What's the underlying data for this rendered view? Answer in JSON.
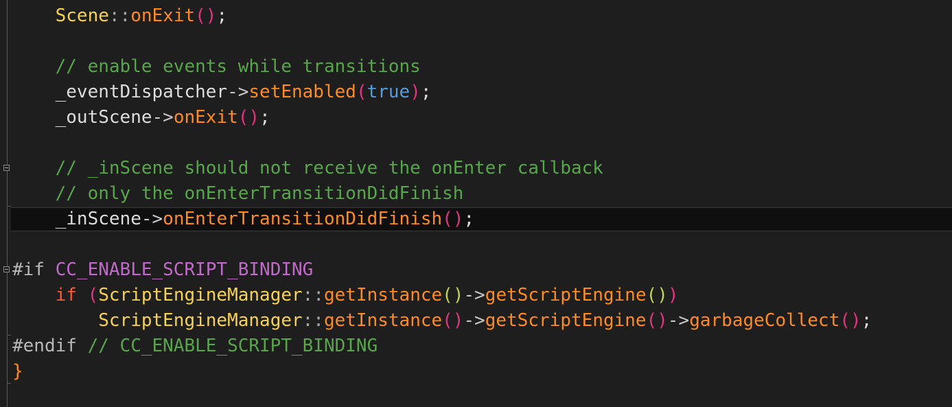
{
  "editor": {
    "lines": [
      {
        "id": 1,
        "indent": "    ",
        "tokens": [
          {
            "t": "Scene",
            "c": "tk-type"
          },
          {
            "t": "::",
            "c": "tk-ns"
          },
          {
            "t": "onExit",
            "c": "tk-func"
          },
          {
            "t": "()",
            "c": "tk-paren"
          },
          {
            "t": ";",
            "c": "tk-punct"
          }
        ]
      },
      {
        "id": 2,
        "indent": "",
        "tokens": []
      },
      {
        "id": 3,
        "indent": "    ",
        "tokens": [
          {
            "t": "// enable events while transitions",
            "c": "tk-comment"
          }
        ]
      },
      {
        "id": 4,
        "indent": "    ",
        "tokens": [
          {
            "t": "_eventDispatcher",
            "c": "tk-var"
          },
          {
            "t": "->",
            "c": "tk-op"
          },
          {
            "t": "setEnabled",
            "c": "tk-func"
          },
          {
            "t": "(",
            "c": "tk-paren"
          },
          {
            "t": "true",
            "c": "tk-kw-blue"
          },
          {
            "t": ")",
            "c": "tk-paren"
          },
          {
            "t": ";",
            "c": "tk-punct"
          }
        ]
      },
      {
        "id": 5,
        "indent": "    ",
        "tokens": [
          {
            "t": "_outScene",
            "c": "tk-var"
          },
          {
            "t": "->",
            "c": "tk-op"
          },
          {
            "t": "onExit",
            "c": "tk-func"
          },
          {
            "t": "()",
            "c": "tk-paren"
          },
          {
            "t": ";",
            "c": "tk-punct"
          }
        ]
      },
      {
        "id": 6,
        "indent": "",
        "tokens": []
      },
      {
        "id": 7,
        "indent": "    ",
        "tokens": [
          {
            "t": "// _inScene should not receive the onEnter callback",
            "c": "tk-comment"
          }
        ]
      },
      {
        "id": 8,
        "indent": "    ",
        "tokens": [
          {
            "t": "// only the onEnterTransitionDidFinish",
            "c": "tk-comment"
          }
        ]
      },
      {
        "id": 9,
        "indent": "    ",
        "tokens": [
          {
            "t": "_inScene",
            "c": "tk-var"
          },
          {
            "t": "->",
            "c": "tk-op"
          },
          {
            "t": "onEnterTransitionDidFinish",
            "c": "tk-func"
          },
          {
            "t": "()",
            "c": "tk-paren"
          },
          {
            "t": ";",
            "c": "tk-punct"
          }
        ]
      },
      {
        "id": 10,
        "indent": "",
        "tokens": []
      },
      {
        "id": 11,
        "indent": "",
        "tokens": [
          {
            "t": "#if ",
            "c": "tk-pre"
          },
          {
            "t": "CC_ENABLE_SCRIPT_BINDING",
            "c": "tk-macro"
          }
        ]
      },
      {
        "id": 12,
        "indent": "    ",
        "tokens": [
          {
            "t": "if",
            "c": "tk-kw-red"
          },
          {
            "t": " ",
            "c": "tk-punct"
          },
          {
            "t": "(",
            "c": "tk-paren"
          },
          {
            "t": "ScriptEngineManager",
            "c": "tk-type"
          },
          {
            "t": "::",
            "c": "tk-ns"
          },
          {
            "t": "getInstance",
            "c": "tk-func"
          },
          {
            "t": "()",
            "c": "tk-paren2"
          },
          {
            "t": "->",
            "c": "tk-op"
          },
          {
            "t": "getScriptEngine",
            "c": "tk-func"
          },
          {
            "t": "()",
            "c": "tk-paren2"
          },
          {
            "t": ")",
            "c": "tk-paren"
          }
        ]
      },
      {
        "id": 13,
        "indent": "        ",
        "tokens": [
          {
            "t": "ScriptEngineManager",
            "c": "tk-type"
          },
          {
            "t": "::",
            "c": "tk-ns"
          },
          {
            "t": "getInstance",
            "c": "tk-func"
          },
          {
            "t": "()",
            "c": "tk-paren"
          },
          {
            "t": "->",
            "c": "tk-op"
          },
          {
            "t": "getScriptEngine",
            "c": "tk-func"
          },
          {
            "t": "()",
            "c": "tk-paren"
          },
          {
            "t": "->",
            "c": "tk-op"
          },
          {
            "t": "garbageCollect",
            "c": "tk-func"
          },
          {
            "t": "()",
            "c": "tk-paren"
          },
          {
            "t": ";",
            "c": "tk-punct"
          }
        ]
      },
      {
        "id": 14,
        "indent": "",
        "tokens": [
          {
            "t": "#endif ",
            "c": "tk-pre"
          },
          {
            "t": "// CC_ENABLE_SCRIPT_BINDING",
            "c": "tk-comment"
          }
        ]
      },
      {
        "id": 15,
        "indent": "",
        "tokens": [
          {
            "t": "}",
            "c": "tk-brace"
          }
        ]
      }
    ],
    "current_line": 9
  }
}
